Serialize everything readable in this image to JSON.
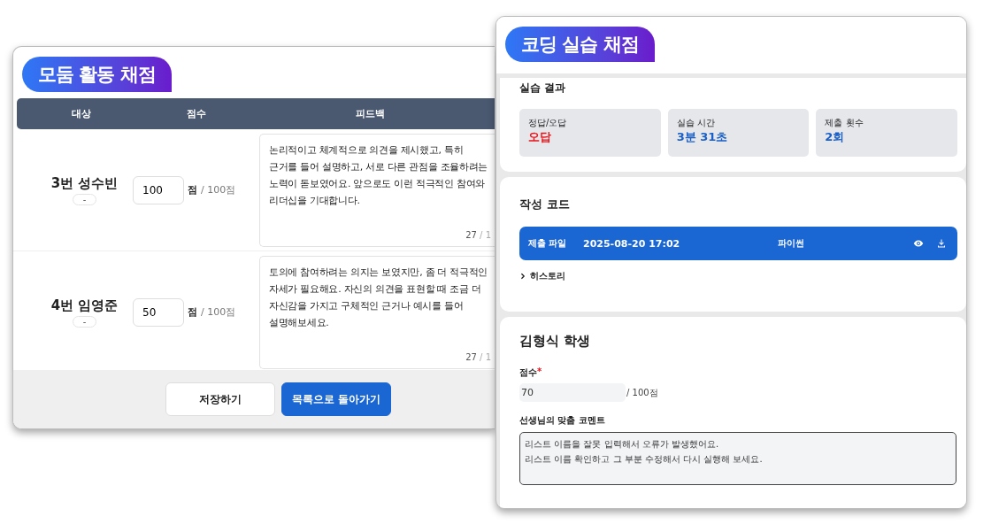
{
  "group_grading": {
    "title": "모둠 활동 채점",
    "columns": [
      "대상",
      "점수",
      "피드백"
    ],
    "rows": [
      {
        "name": "3번 성수빈",
        "badge": "-",
        "score": "100",
        "unit": "점",
        "max": "/ 100점",
        "feedback": "논리적이고 체계적으로 의견을 제시했고, 특히\n근거를 들어 설명하고, 서로 다른 관점을 조율하려는\n노력이 돋보였어요. 앞으로도 이런 적극적인 참여와\n리더십을 기대합니다.",
        "count": "27",
        "count_max": "/ 1"
      },
      {
        "name": "4번 임영준",
        "badge": "-",
        "score": "50",
        "unit": "점",
        "max": "/ 100점",
        "feedback": "토의에 참여하려는 의지는 보였지만, 좀 더 적극적인\n자세가 필요해요. 자신의 의견을 표현할 때 조금 더\n자신감을 가지고 구체적인 근거나 예시를 들어\n설명해보세요.",
        "count": "27",
        "count_max": "/ 1"
      }
    ],
    "buttons": [
      {
        "label": "저장하기",
        "kind": "secondary"
      },
      {
        "label": "목록으로 돌아가기",
        "kind": "primary"
      }
    ]
  },
  "coding_grading": {
    "title": "코딩 실습 채점",
    "result": {
      "heading": "실습 결과",
      "stats": [
        {
          "label": "정답/오답",
          "value": "오답",
          "color": "#e8141b"
        },
        {
          "label": "실습 시간",
          "value": "3분 31초",
          "color": "#1a5fc8"
        },
        {
          "label": "제출 횟수",
          "value": "2회",
          "color": "#1a5fc8"
        }
      ]
    },
    "code": {
      "heading": "작성 코드",
      "file": {
        "label": "제출 파일",
        "date": "2025-08-20 17:02",
        "language": "파이썬"
      },
      "history": {
        "label": "히스토리",
        "expanded": false
      }
    },
    "student": {
      "name": "김형식 학생",
      "score_label": "점수",
      "required_mark": "*",
      "score": "70",
      "max": "/ 100점",
      "comment_label": "선생님의 맞춤 코멘트",
      "comment": "리스트 이름을 잘못 입력해서 오류가 발생했어요.\n리스트 이름 확인하고 그 부분 수정해서 다시 실행해 보세요."
    }
  }
}
